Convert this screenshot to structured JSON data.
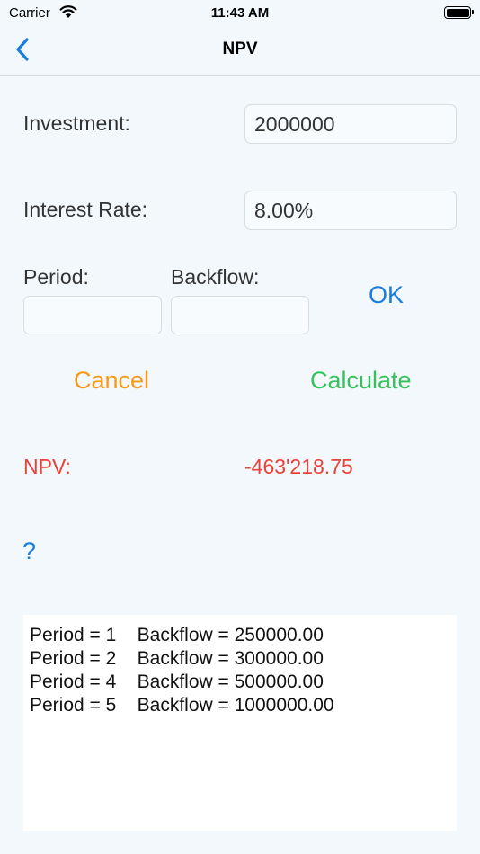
{
  "status_bar": {
    "carrier": "Carrier",
    "time": "11:43 AM",
    "battery_level": 1.0
  },
  "nav": {
    "title": "NPV",
    "back_icon": "chevron-left-icon"
  },
  "form": {
    "investment_label": "Investment:",
    "investment_value": "2000000",
    "interest_label": "Interest Rate:",
    "interest_value": "8.00%",
    "period_label": "Period:",
    "period_value": "",
    "backflow_label": "Backflow:",
    "backflow_value": ""
  },
  "buttons": {
    "ok": "OK",
    "cancel": "Cancel",
    "calculate": "Calculate",
    "help": "?"
  },
  "result": {
    "label": "NPV:",
    "value": "-463'218.75"
  },
  "output": {
    "rows": [
      "Period = 1    Backflow = 250000.00",
      "Period = 2    Backflow = 300000.00",
      "Period = 4    Backflow = 500000.00",
      "Period = 5    Backflow = 1000000.00"
    ]
  },
  "colors": {
    "accent_blue": "#1a7de0",
    "cancel_orange": "#f59a1b",
    "calculate_green": "#35c25a",
    "result_red": "#e8423a"
  }
}
